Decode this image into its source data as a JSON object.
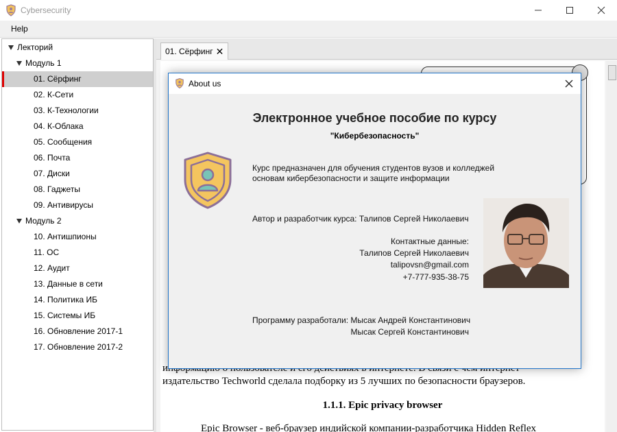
{
  "window": {
    "title": "Cybersecurity"
  },
  "menu": {
    "items": [
      "Help"
    ]
  },
  "sidebar": {
    "items": [
      {
        "label": "Лекторий",
        "level": 0,
        "expanded": true
      },
      {
        "label": "Модуль 1",
        "level": 1,
        "expanded": true
      },
      {
        "label": "01. Сёрфинг",
        "level": 2,
        "selected": true
      },
      {
        "label": "02. К-Сети",
        "level": 2
      },
      {
        "label": "03. К-Технологии",
        "level": 2
      },
      {
        "label": "04. К-Облака",
        "level": 2
      },
      {
        "label": "05. Сообщения",
        "level": 2
      },
      {
        "label": "06. Почта",
        "level": 2
      },
      {
        "label": "07. Диски",
        "level": 2
      },
      {
        "label": "08. Гаджеты",
        "level": 2
      },
      {
        "label": "09. Антивирусы",
        "level": 2
      },
      {
        "label": "Модуль 2",
        "level": 1,
        "expanded": true
      },
      {
        "label": "10. Антишпионы",
        "level": 2
      },
      {
        "label": "11. ОС",
        "level": 2
      },
      {
        "label": "12. Аудит",
        "level": 2
      },
      {
        "label": "13. Данные в сети",
        "level": 2
      },
      {
        "label": "14. Политика ИБ",
        "level": 2
      },
      {
        "label": "15. Системы ИБ",
        "level": 2
      },
      {
        "label": "16. Обновление 2017-1",
        "level": 2
      },
      {
        "label": "17. Обновление 2017-2",
        "level": 2
      }
    ]
  },
  "tab": {
    "label": "01. Сёрфинг"
  },
  "document": {
    "line_1": "информацию о пользователе и его действиях в интернете. В связи с чем интернет",
    "line_2": "издательство Techworld сделала подборку из 5 лучших по безопасности браузеров.",
    "heading": "1.1.1. Epic privacy browser",
    "line_3": "Epic Browser - веб-браузер индийской компании-разработчика Hidden Reflex"
  },
  "dialog": {
    "title": "About us",
    "heading": "Электронное учебное пособие по курсу",
    "subheading": "\"Кибербезопасность\"",
    "description_1": "Курс предназначен для обучения студентов вузов и колледжей",
    "description_2": "основам кибербезопасности и защите информации",
    "author": "Автор и разработчик курса: Талипов Сергей Николаевич",
    "contacts_label": "Контактные данные:",
    "contact_name": "Талипов Сергей Николаевич",
    "contact_email": "talipovsn@gmail.com",
    "contact_phone": "+7-777-935-38-75",
    "developers_1": "Программу разработали: Мысак Андрей Константинович",
    "developers_2": "Мысак Сергей Константинович"
  }
}
